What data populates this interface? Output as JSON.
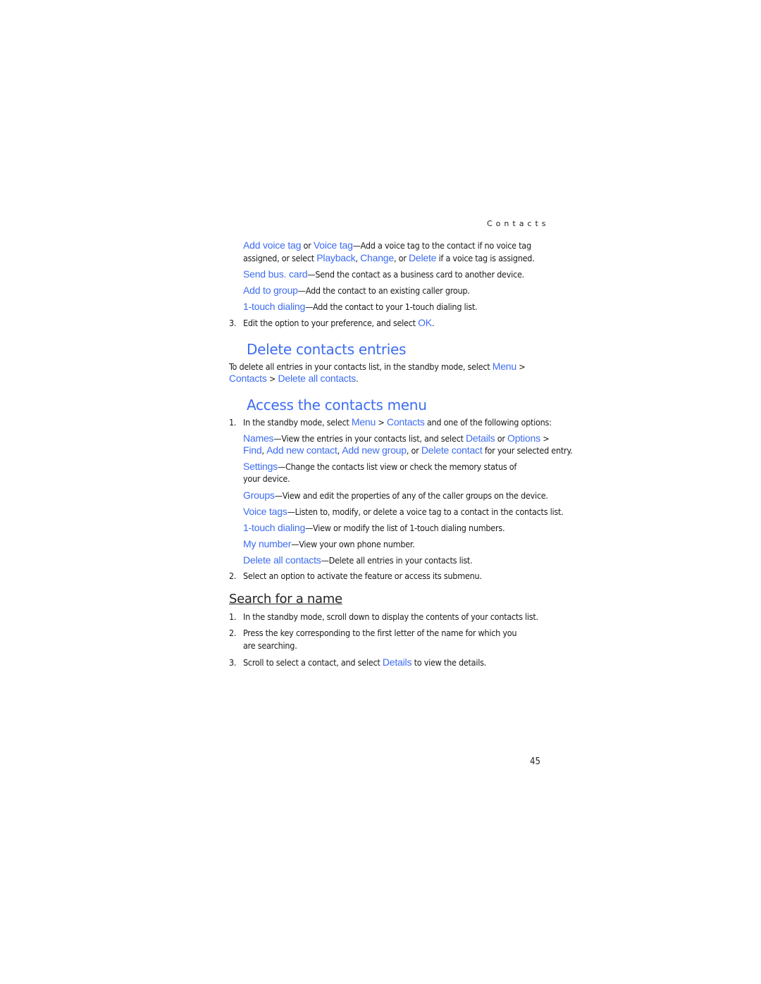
{
  "running_header": "Contacts",
  "page_number": "45",
  "colors": {
    "ui_text": "#3d6cf0",
    "body_text": "#1a1a1a"
  },
  "voice_tag_item": {
    "ui1": "Add voice tag",
    "or1": " or ",
    "ui2": "Voice tag",
    "desc1": "—Add a voice tag to the contact if no voice tag",
    "desc2_pre": "assigned, or select ",
    "ui3": "Playback",
    "sep1": ", ",
    "ui4": "Change",
    "sep2": ", or ",
    "ui5": "Delete",
    "desc2_post": " if a voice tag is assigned."
  },
  "send_item": {
    "ui": "Send bus. card",
    "desc": "—Send the contact as a business card to another device."
  },
  "group_item": {
    "ui": "Add to group",
    "desc": "—Add the contact to an existing caller group."
  },
  "touch_item": {
    "ui": "1-touch dialing",
    "desc": "—Add the contact to your 1-touch dialing list."
  },
  "step3": {
    "num": "3.",
    "text": "Edit the option to your preference, and select ",
    "ui": "OK",
    "end": "."
  },
  "delete_section": {
    "heading": "Delete contacts entries",
    "text1": "To delete all entries in your contacts list, in the standby mode, select ",
    "ui1": "Menu",
    "gt1": " >",
    "ui2": "Contacts",
    "gt2": " > ",
    "ui3": "Delete all contacts",
    "end": "."
  },
  "access_section": {
    "heading": "Access the contacts menu",
    "step1": {
      "num": "1.",
      "text": "In the standby mode, select ",
      "ui1": "Menu",
      "gt": " > ",
      "ui2": "Contacts",
      "end": " and one of the following options:"
    },
    "names": {
      "ui": "Names",
      "desc": "—View the entries in your contacts list, and select ",
      "ui2": "Details",
      "or": " or ",
      "ui3": "Options",
      "gt": " >",
      "ui4": "Find",
      "c1": ", ",
      "ui5": "Add new contact",
      "c2": ", ",
      "ui6": "Add new group",
      "c3": ", or ",
      "ui7": "Delete contact",
      "end": " for your selected entry."
    },
    "settings": {
      "ui": "Settings",
      "desc1": "—Change the contacts list view or check the memory status of",
      "desc2": "your device."
    },
    "groups": {
      "ui": "Groups",
      "desc": "—View and edit the properties of any of the caller groups on the device."
    },
    "voice_tags": {
      "ui": "Voice tags",
      "desc": "—Listen to, modify, or delete a voice tag to a contact in the contacts list."
    },
    "touch": {
      "ui": "1-touch dialing",
      "desc": "—View or modify the list of 1-touch dialing numbers."
    },
    "my_number": {
      "ui": "My number",
      "desc": "—View your own phone number."
    },
    "delete_all": {
      "ui": "Delete all contacts",
      "desc": "—Delete all entries in your contacts list."
    },
    "step2": {
      "num": "2.",
      "text": "Select an option to activate the feature or access its submenu."
    }
  },
  "search_section": {
    "heading": "Search for a name",
    "step1": {
      "num": "1.",
      "text": "In the standby mode, scroll down to display the contents of your contacts list."
    },
    "step2": {
      "num": "2.",
      "text1": "Press the key corresponding to the first letter of the name for which you",
      "text2": "are searching."
    },
    "step3": {
      "num": "3.",
      "text": "Scroll to select a contact, and select ",
      "ui": "Details",
      "end": " to view the details."
    }
  }
}
